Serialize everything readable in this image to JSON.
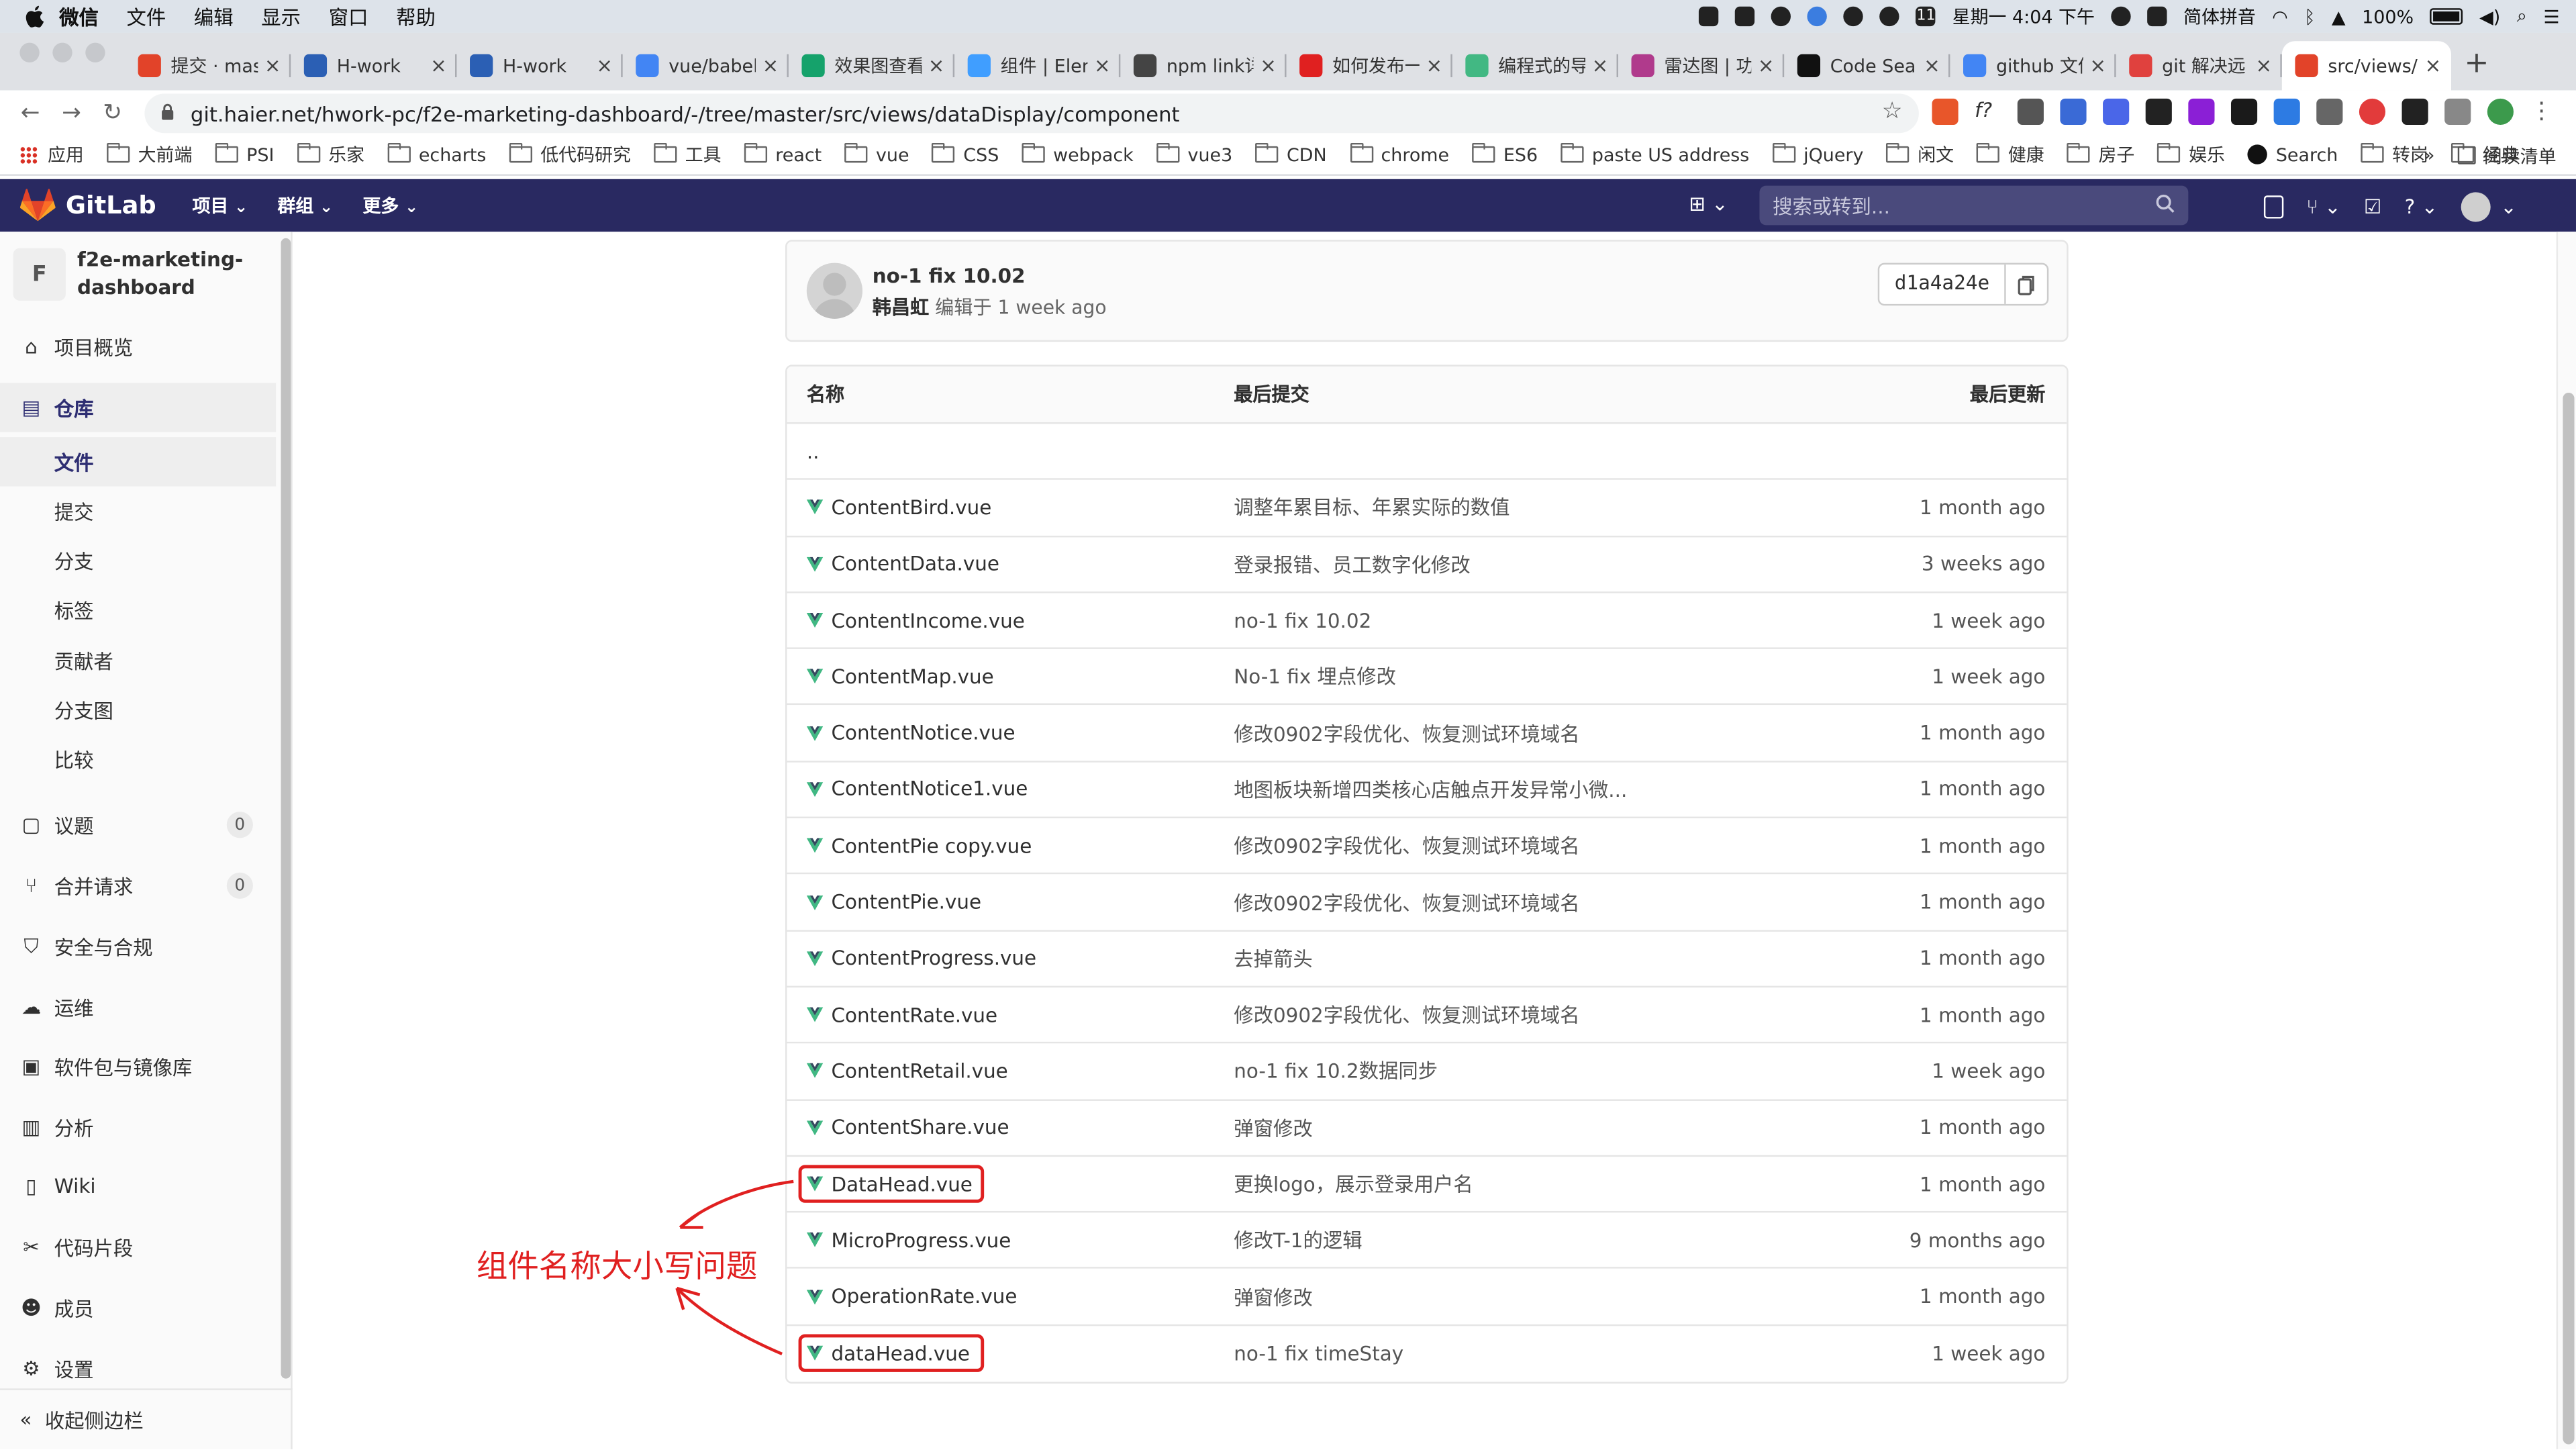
{
  "menubar": {
    "app": "微信",
    "items": [
      "文件",
      "编辑",
      "显示",
      "窗口",
      "帮助"
    ],
    "datetime": "星期一 4:04 下午",
    "input_method": "简体拼音",
    "battery": "100%",
    "calendar_day": "11"
  },
  "tabs": [
    {
      "label": "提交 · mas",
      "icon": "gitlab-icon",
      "color": "#e24329"
    },
    {
      "label": "H-work",
      "icon": "h-work-icon",
      "color": "#2b5fb4"
    },
    {
      "label": "H-work",
      "icon": "h-work-icon",
      "color": "#2b5fb4"
    },
    {
      "label": "vue/babel",
      "icon": "google-icon",
      "color": "#4285f4"
    },
    {
      "label": "效果图查看",
      "icon": "play-icon",
      "color": "#15a26b"
    },
    {
      "label": "组件 | Elem",
      "icon": "element-icon",
      "color": "#409eff"
    },
    {
      "label": "npm link详",
      "icon": "avatar-icon",
      "color": "#444444"
    },
    {
      "label": "如何发布一",
      "icon": "toutiao-icon",
      "color": "#e02020"
    },
    {
      "label": "编程式的导",
      "icon": "vue-icon",
      "color": "#42b883"
    },
    {
      "label": "雷达图 | 功",
      "icon": "antv-icon",
      "color": "#b03a8c"
    },
    {
      "label": "Code Sear",
      "icon": "github-icon",
      "color": "#111111"
    },
    {
      "label": "github 文件",
      "icon": "google-icon",
      "color": "#4285f4"
    },
    {
      "label": "git 解决远",
      "icon": "csdn-icon",
      "color": "#e0413e"
    },
    {
      "label": "src/views/",
      "icon": "gitlab-icon",
      "color": "#e24329",
      "active": true
    }
  ],
  "address": {
    "url": "git.haier.net/hwork-pc/f2e-marketing-dashboard/-/tree/master/src/views/dataDisplay/component"
  },
  "bookmarks": [
    {
      "label": "应用",
      "type": "apps"
    },
    {
      "label": "大前端",
      "type": "folder"
    },
    {
      "label": "PSI",
      "type": "folder"
    },
    {
      "label": "乐家",
      "type": "folder"
    },
    {
      "label": "echarts",
      "type": "folder"
    },
    {
      "label": "低代码研究",
      "type": "folder"
    },
    {
      "label": "工具",
      "type": "folder"
    },
    {
      "label": "react",
      "type": "folder"
    },
    {
      "label": "vue",
      "type": "folder"
    },
    {
      "label": "CSS",
      "type": "folder"
    },
    {
      "label": "webpack",
      "type": "folder"
    },
    {
      "label": "vue3",
      "type": "folder"
    },
    {
      "label": "CDN",
      "type": "folder"
    },
    {
      "label": "chrome",
      "type": "folder"
    },
    {
      "label": "ES6",
      "type": "folder"
    },
    {
      "label": "paste US address",
      "type": "folder"
    },
    {
      "label": "jQuery",
      "type": "folder"
    },
    {
      "label": "闲文",
      "type": "folder"
    },
    {
      "label": "健康",
      "type": "folder"
    },
    {
      "label": "房子",
      "type": "folder"
    },
    {
      "label": "娱乐",
      "type": "folder"
    },
    {
      "label": "Search",
      "type": "github"
    },
    {
      "label": "转岗",
      "type": "folder"
    },
    {
      "label": "经典",
      "type": "folder"
    }
  ],
  "bookmarks_more": "»",
  "reading_list": "阅读清单",
  "gitlab": {
    "brand": "GitLab",
    "nav": [
      "项目",
      "群组",
      "更多"
    ],
    "search_placeholder": "搜索或转到..."
  },
  "sidebar": {
    "project_initial": "F",
    "project_name_line1": "f2e-marketing-",
    "project_name_line2": "dashboard",
    "items": [
      {
        "label": "项目概览",
        "icon": "home-icon"
      },
      {
        "label": "仓库",
        "icon": "doc-icon",
        "active": true
      },
      {
        "label": "文件",
        "sub": true,
        "active": true
      },
      {
        "label": "提交",
        "sub": true
      },
      {
        "label": "分支",
        "sub": true
      },
      {
        "label": "标签",
        "sub": true
      },
      {
        "label": "贡献者",
        "sub": true
      },
      {
        "label": "分支图",
        "sub": true
      },
      {
        "label": "比较",
        "sub": true
      },
      {
        "label": "议题",
        "icon": "issues-icon",
        "badge": "0"
      },
      {
        "label": "合并请求",
        "icon": "merge-icon",
        "badge": "0"
      },
      {
        "label": "安全与合规",
        "icon": "shield-icon"
      },
      {
        "label": "运维",
        "icon": "cloud-icon"
      },
      {
        "label": "软件包与镜像库",
        "icon": "package-icon"
      },
      {
        "label": "分析",
        "icon": "chart-icon"
      },
      {
        "label": "Wiki",
        "icon": "book-icon"
      },
      {
        "label": "代码片段",
        "icon": "scissors-icon"
      },
      {
        "label": "成员",
        "icon": "users-icon"
      },
      {
        "label": "设置",
        "icon": "gear-icon"
      }
    ],
    "collapse_label": "收起侧边栏"
  },
  "commit": {
    "title": "no-1 fix 10.02",
    "author": "韩昌虹",
    "edited": "编辑于 1 week ago",
    "sha": "d1a4a24e"
  },
  "tree": {
    "headers": {
      "name": "名称",
      "last_commit": "最后提交",
      "last_update": "最后更新"
    },
    "parent": "..",
    "rows": [
      {
        "name": "ContentBird.vue",
        "commit": "调整年累目标、年累实际的数值",
        "updated": "1 month ago"
      },
      {
        "name": "ContentData.vue",
        "commit": "登录报错、员工数字化修改",
        "updated": "3 weeks ago"
      },
      {
        "name": "ContentIncome.vue",
        "commit": "no-1 fix 10.02",
        "updated": "1 week ago"
      },
      {
        "name": "ContentMap.vue",
        "commit": "No-1 fix 埋点修改",
        "updated": "1 week ago"
      },
      {
        "name": "ContentNotice.vue",
        "commit": "修改0902字段优化、恢复测试环境域名",
        "updated": "1 month ago"
      },
      {
        "name": "ContentNotice1.vue",
        "commit": "地图板块新增四类核心店触点开发异常小微...",
        "updated": "1 month ago"
      },
      {
        "name": "ContentPie copy.vue",
        "commit": "修改0902字段优化、恢复测试环境域名",
        "updated": "1 month ago"
      },
      {
        "name": "ContentPie.vue",
        "commit": "修改0902字段优化、恢复测试环境域名",
        "updated": "1 month ago"
      },
      {
        "name": "ContentProgress.vue",
        "commit": "去掉箭头",
        "updated": "1 month ago"
      },
      {
        "name": "ContentRate.vue",
        "commit": "修改0902字段优化、恢复测试环境域名",
        "updated": "1 month ago"
      },
      {
        "name": "ContentRetail.vue",
        "commit": "no-1 fix 10.2数据同步",
        "updated": "1 week ago"
      },
      {
        "name": "ContentShare.vue",
        "commit": "弹窗修改",
        "updated": "1 month ago"
      },
      {
        "name": "DataHead.vue",
        "commit": "更换logo，展示登录用户名",
        "updated": "1 month ago",
        "highlight": true
      },
      {
        "name": "MicroProgress.vue",
        "commit": "修改T-1的逻辑",
        "updated": "9 months ago"
      },
      {
        "name": "OperationRate.vue",
        "commit": "弹窗修改",
        "updated": "1 month ago"
      },
      {
        "name": "dataHead.vue",
        "commit": "no-1 fix timeStay",
        "updated": "1 week ago",
        "highlight": true
      }
    ]
  },
  "annotation": {
    "text": "组件名称大小写问题",
    "color": "#e02020"
  }
}
